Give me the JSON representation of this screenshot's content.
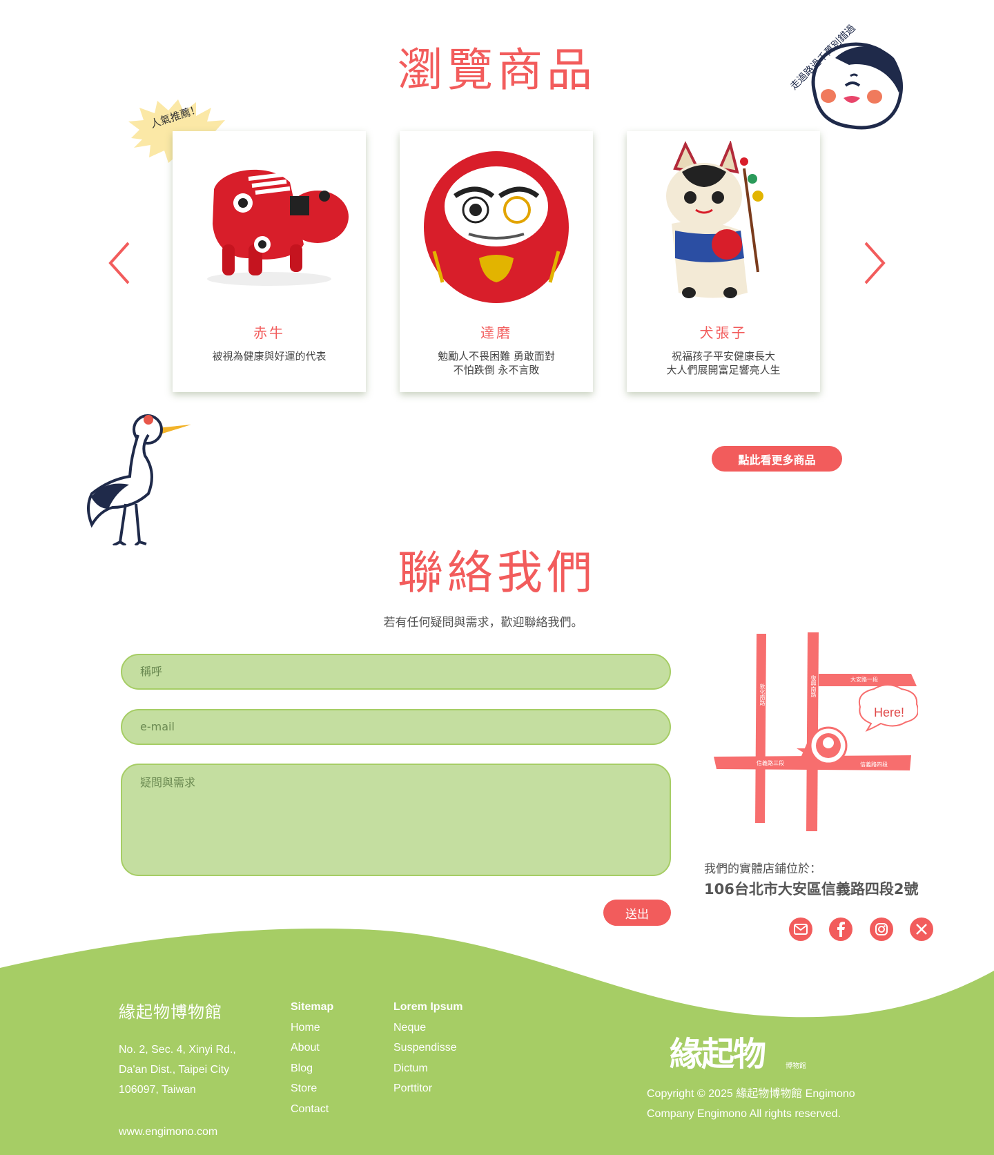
{
  "products": {
    "title": "瀏覽商品",
    "badge": "人氣推薦！",
    "cards": [
      {
        "name": "赤牛",
        "desc": [
          "被視為健康與好運的代表"
        ]
      },
      {
        "name": "達磨",
        "desc": [
          "勉勵人不畏困難 勇敢面對",
          "不怕跌倒 永不言敗"
        ]
      },
      {
        "name": "犬張子",
        "desc": [
          "祝福孩子平安健康長大",
          "大人們展開富足響亮人生"
        ]
      }
    ],
    "more_button": "點此看更多商品",
    "face_caption": "走過路過千萬別錯過"
  },
  "contact": {
    "title": "聯絡我們",
    "intro": "若有任何疑問與需求，歡迎聯絡我們。",
    "name_placeholder": "稱呼",
    "email_placeholder": "e-mail",
    "message_placeholder": "疑問與需求",
    "send_button": "送出",
    "map": {
      "here_label": "Here!",
      "streets": [
        "大安路一段",
        "信義路三段",
        "信義路四段",
        "敦化南路",
        "復興南路"
      ]
    },
    "store_label": "我們的實體店鋪位於：",
    "store_address": "106台北市大安區信義路四段2號",
    "social_icons": [
      "mail-icon",
      "facebook-icon",
      "instagram-icon",
      "x-icon"
    ]
  },
  "footer": {
    "brand": "緣起物博物館",
    "address": [
      "No. 2, Sec. 4, Xinyi Rd.,",
      "Da'an Dist., Taipei City",
      "106097, Taiwan"
    ],
    "website": "www.engimono.com",
    "sitemap": {
      "heading": "Sitemap",
      "links": [
        "Home",
        "About",
        "Blog",
        "Store",
        "Contact"
      ]
    },
    "lorem": {
      "heading": "Lorem Ipsum",
      "links": [
        "Neque",
        "Suspendisse",
        "Dictum",
        "Porttitor"
      ]
    },
    "logo_text": "緣起物",
    "logo_sub": "博物館",
    "copyright": [
      "Copyright ©  2025 緣起物博物館 Engimono",
      "Company Engimono All rights reserved."
    ]
  },
  "colors": {
    "accent": "#f25c5c",
    "green": "#a6cd65",
    "field": "#c4dea0",
    "navy": "#1f2a4a"
  }
}
